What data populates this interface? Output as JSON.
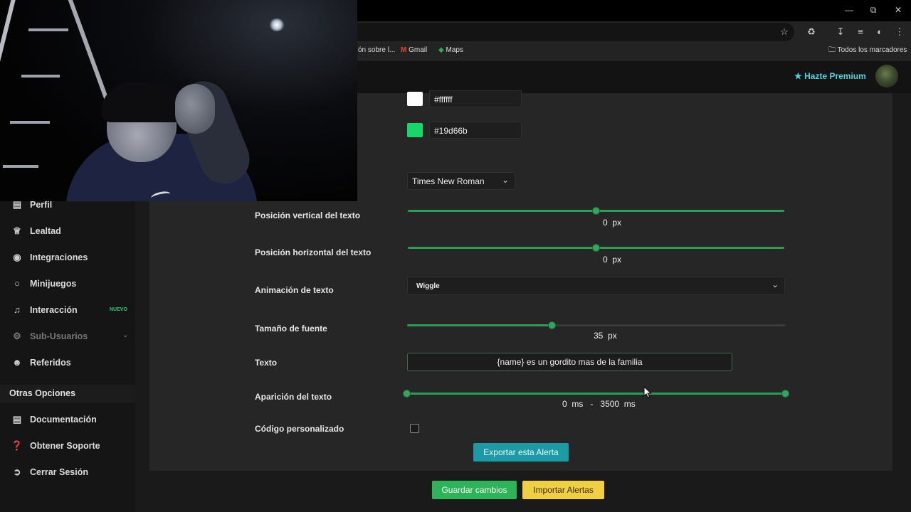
{
  "browser": {
    "bookmarks": [
      {
        "label": "ón sobre l...",
        "icon": "page-icon"
      },
      {
        "label": "Gmail",
        "icon": "gmail-icon"
      },
      {
        "label": "Maps",
        "icon": "maps-icon"
      }
    ],
    "all_bookmarks_label": "Todos los marcadores"
  },
  "header": {
    "premium_label": "Hazte Premium"
  },
  "sidebar": {
    "items": [
      {
        "label": "Perfil",
        "icon": "id-card-icon"
      },
      {
        "label": "Lealtad",
        "icon": "trophy-icon"
      },
      {
        "label": "Integraciones",
        "icon": "discord-icon"
      },
      {
        "label": "Minijuegos",
        "icon": "gamepad-icon"
      },
      {
        "label": "Interacción",
        "icon": "music-icon",
        "badge": "NUEVO"
      },
      {
        "label": "Sub-Usuarios",
        "icon": "gear-icon"
      },
      {
        "label": "Referidos",
        "icon": "users-icon"
      }
    ],
    "section_title": "Otras Opciones",
    "other_items": [
      {
        "label": "Documentación",
        "icon": "book-icon"
      },
      {
        "label": "Obtener Soporte",
        "icon": "question-icon"
      },
      {
        "label": "Cerrar Sesión",
        "icon": "logout-icon"
      }
    ]
  },
  "form": {
    "color1": {
      "hex": "#ffffff",
      "swatch": "#ffffff"
    },
    "color2": {
      "hex": "#19d66b",
      "swatch": "#19d66b"
    },
    "font_family": "Times New Roman",
    "vertical_position": {
      "label": "Posición vertical del texto",
      "value": "0",
      "unit": "px",
      "fraction": 0.5
    },
    "horizontal_position": {
      "label": "Posición horizontal del texto",
      "value": "0",
      "unit": "px",
      "fraction": 0.5
    },
    "animation": {
      "label": "Animación de texto",
      "selected": "Wiggle"
    },
    "font_size": {
      "label": "Tamaño de fuente",
      "value": "35",
      "unit": "px",
      "fraction": 0.38
    },
    "text": {
      "label": "Texto",
      "value": "{name} es un gordito mas de la familia"
    },
    "appearance": {
      "label": "Aparición del texto",
      "min": "0",
      "max": "3500",
      "unit": "ms",
      "separator": "-"
    },
    "custom_code": {
      "label": "Código personalizado",
      "checked": false
    }
  },
  "buttons": {
    "export": "Exportar esta Alerta",
    "save": "Guardar cambios",
    "import": "Importar Alertas"
  },
  "colors": {
    "accent_green": "#2eb35a",
    "accent_teal": "#1d9aa6",
    "accent_yellow": "#f0cf47",
    "premium_cyan": "#4fd3e0"
  }
}
